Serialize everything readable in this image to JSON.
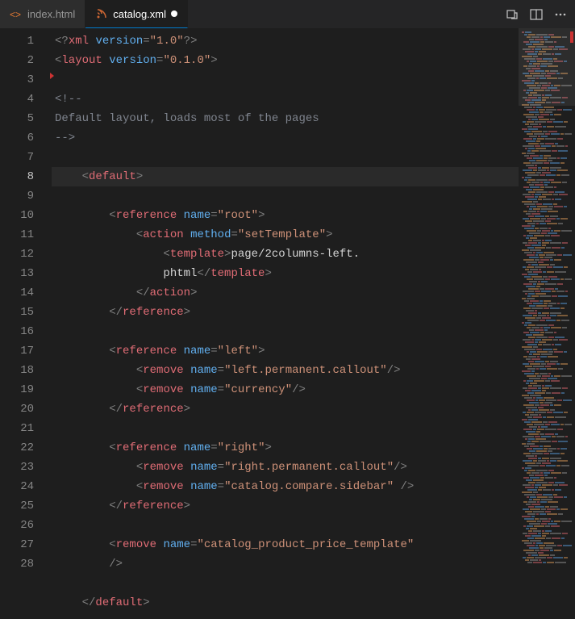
{
  "tabs": [
    {
      "name": "index.html",
      "active": false,
      "dirty": false,
      "icon": "html"
    },
    {
      "name": "catalog.xml",
      "active": true,
      "dirty": true,
      "icon": "xml"
    }
  ],
  "gutter": {
    "lines": [
      "1",
      "2",
      "3",
      "4",
      "5",
      "6",
      "7",
      "8",
      "9",
      "10",
      "11",
      "12",
      "",
      "13",
      "14",
      "15",
      "16",
      "17",
      "18",
      "19",
      "20",
      "21",
      "22",
      "23",
      "24",
      "25",
      "26",
      "",
      "27",
      "28"
    ],
    "current": 8
  },
  "code": {
    "l1": {
      "pre": "<?",
      "tag": "xml",
      "sp": " ",
      "attr": "version",
      "eq": "=",
      "str": "\"1.0\"",
      "post": "?>"
    },
    "l2": {
      "pre": "<",
      "tag": "layout",
      "sp": " ",
      "attr": "version",
      "eq": "=",
      "str": "\"0.1.0\"",
      "post": ">"
    },
    "l4": "<!--",
    "l5": "Default layout, loads most of the pages",
    "l6": "-->",
    "l8": {
      "pre": "<",
      "tag": "default",
      "post": ">"
    },
    "l10": {
      "pre": "<",
      "tag": "reference",
      "sp": " ",
      "attr": "name",
      "eq": "=",
      "str": "\"root\"",
      "post": ">"
    },
    "l11": {
      "pre": "<",
      "tag": "action",
      "sp": " ",
      "attr": "method",
      "eq": "=",
      "str": "\"setTemplate\"",
      "post": ">"
    },
    "l12a": {
      "pre": "<",
      "tag": "template",
      "post": ">",
      "text": "page/2columns-left."
    },
    "l12b": {
      "text": "phtml",
      "pre": "</",
      "tag": "template",
      "post": ">"
    },
    "l13": {
      "pre": "</",
      "tag": "action",
      "post": ">"
    },
    "l14": {
      "pre": "</",
      "tag": "reference",
      "post": ">"
    },
    "l16": {
      "pre": "<",
      "tag": "reference",
      "sp": " ",
      "attr": "name",
      "eq": "=",
      "str": "\"left\"",
      "post": ">"
    },
    "l17": {
      "pre": "<",
      "tag": "remove",
      "sp": " ",
      "attr": "name",
      "eq": "=",
      "str": "\"left.permanent.callout\"",
      "post": "/>"
    },
    "l18": {
      "pre": "<",
      "tag": "remove",
      "sp": " ",
      "attr": "name",
      "eq": "=",
      "str": "\"currency\"",
      "post": "/>"
    },
    "l19": {
      "pre": "</",
      "tag": "reference",
      "post": ">"
    },
    "l21": {
      "pre": "<",
      "tag": "reference",
      "sp": " ",
      "attr": "name",
      "eq": "=",
      "str": "\"right\"",
      "post": ">"
    },
    "l22": {
      "pre": "<",
      "tag": "remove",
      "sp": " ",
      "attr": "name",
      "eq": "=",
      "str": "\"right.permanent.callout\"",
      "post": "/>"
    },
    "l23": {
      "pre": "<",
      "tag": "remove",
      "sp": " ",
      "attr": "name",
      "eq": "=",
      "str": "\"catalog.compare.sidebar\"",
      "post": " />"
    },
    "l24": {
      "pre": "</",
      "tag": "reference",
      "post": ">"
    },
    "l26a": {
      "pre": "<",
      "tag": "remove",
      "sp": " ",
      "attr": "name",
      "eq": "=",
      "str": "\"catalog_product_price_template\""
    },
    "l26b": {
      "post": "/>"
    },
    "l28": {
      "pre": "</",
      "tag": "default",
      "post": ">"
    }
  }
}
